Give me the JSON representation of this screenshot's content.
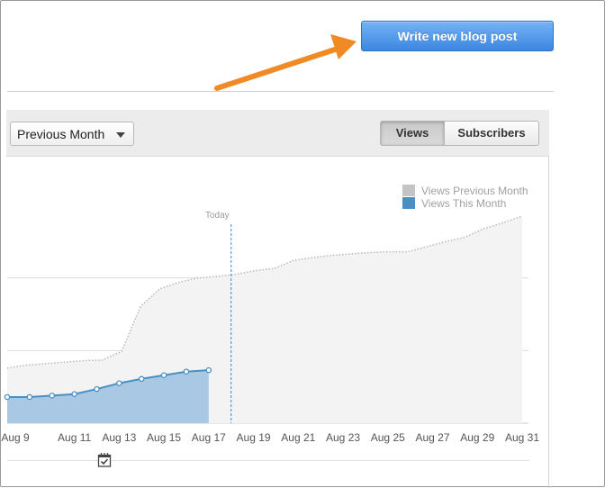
{
  "header": {
    "write_button_label": "Write new blog post"
  },
  "toolbar": {
    "period_select_value": "Previous Month",
    "tabs": [
      {
        "label": "Views",
        "active": true
      },
      {
        "label": "Subscribers",
        "active": false
      }
    ]
  },
  "colors": {
    "accent_blue": "#3d86e0",
    "this_month": "#4a8fc4",
    "this_month_fill": "#a8c8e4",
    "prev_month": "#c4c4c4",
    "prev_month_fill": "#f3f3f3",
    "annotation_arrow": "#f08a24"
  },
  "icons": [
    "calendar-check-icon",
    "chevron-down-icon",
    "arrow-annotation"
  ],
  "chart_data": {
    "type": "area",
    "legend": [
      {
        "label": "Views Previous Month",
        "color": "#c4c4c4"
      },
      {
        "label": "Views This Month",
        "color": "#4a8fc4"
      }
    ],
    "today_label": "Today",
    "x_tick_labels": [
      "Aug 9",
      "Aug 11",
      "Aug 13",
      "Aug 15",
      "Aug 17",
      "Aug 19",
      "Aug 21",
      "Aug 23",
      "Aug 25",
      "Aug 27",
      "Aug 29",
      "Aug 31"
    ],
    "x": [
      8,
      9,
      10,
      11,
      12,
      13,
      14,
      15,
      16,
      17,
      18,
      19,
      20,
      21,
      22,
      23,
      24,
      25,
      26,
      27,
      28,
      29,
      30,
      31
    ],
    "series": [
      {
        "name": "Views Previous Month",
        "values": [
          0.76,
          0.8,
          0.82,
          0.84,
          0.86,
          0.87,
          0.99,
          1.61,
          1.85,
          1.94,
          2.0,
          2.02,
          2.05,
          2.1,
          2.13,
          2.24,
          2.28,
          2.31,
          2.33,
          2.35,
          2.36,
          2.36,
          2.43,
          2.5,
          2.56,
          2.68,
          2.76,
          2.85
        ]
      },
      {
        "name": "Views This Month",
        "values": [
          0.36,
          0.36,
          0.38,
          0.4,
          0.47,
          0.55,
          0.61,
          0.66,
          0.71,
          0.73
        ]
      }
    ],
    "ylim": [
      0,
      3
    ],
    "grid": true,
    "today_x": 18
  }
}
